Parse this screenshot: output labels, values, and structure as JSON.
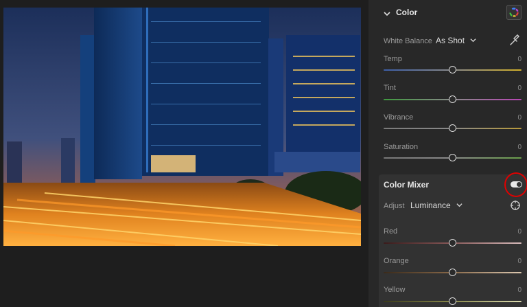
{
  "color_section": {
    "title": "Color",
    "white_balance_label": "White Balance",
    "white_balance_value": "As Shot",
    "sliders": [
      {
        "label": "Temp",
        "value": "0"
      },
      {
        "label": "Tint",
        "value": "0"
      },
      {
        "label": "Vibrance",
        "value": "0"
      },
      {
        "label": "Saturation",
        "value": "0"
      }
    ]
  },
  "color_mixer": {
    "title": "Color Mixer",
    "adjust_label": "Adjust",
    "adjust_value": "Luminance",
    "sliders": [
      {
        "label": "Red",
        "value": "0"
      },
      {
        "label": "Orange",
        "value": "0"
      },
      {
        "label": "Yellow",
        "value": "0"
      }
    ]
  },
  "colors": {
    "panel_bg": "#282828",
    "app_bg": "#1e1e1e",
    "highlight_ring": "#e00000"
  }
}
